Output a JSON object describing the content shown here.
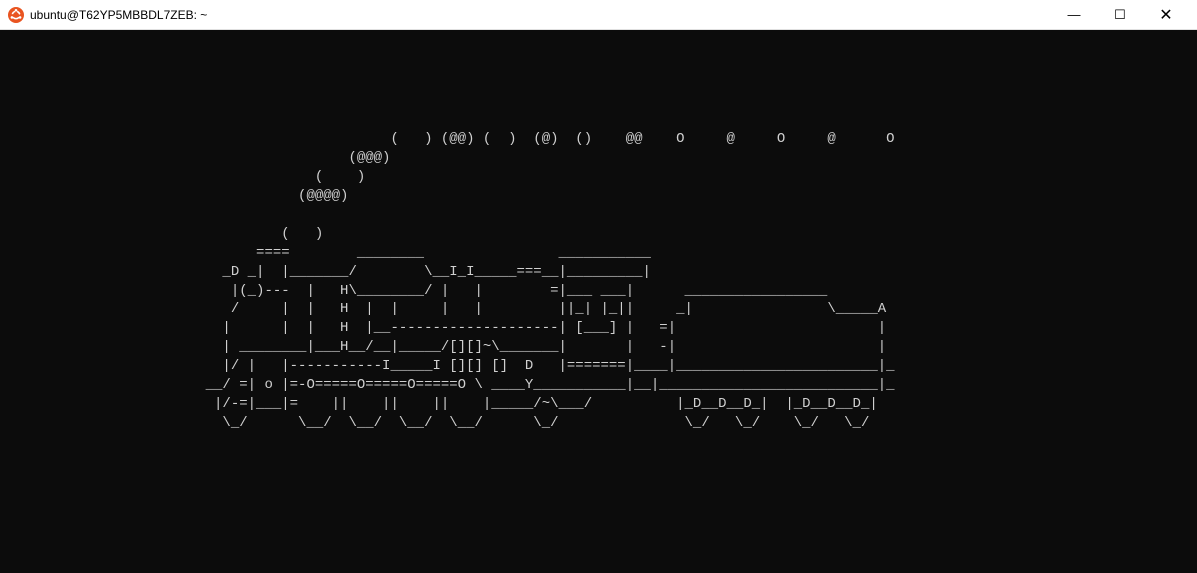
{
  "window": {
    "title": "ubuntu@T62YP5MBBDL7ZEB: ~",
    "minimize_symbol": "—",
    "maximize_symbol": "☐",
    "close_symbol": "✕"
  },
  "terminal": {
    "ascii_art": "\n\n\n\n                                              (   ) (@@) (  )  (@)  ()    @@    O     @     O     @      O\n                                         (@@@)\n                                     (    )\n                                   (@@@@)\n\n                                 (   )\n                              ====        ________                ___________\n                          _D _|  |_______/        \\__I_I_____===__|_________|\n                           |(_)---  |   H\\________/ |   |        =|___ ___|      _________________\n                           /     |  |   H  |  |     |   |         ||_| |_||     _|                \\_____A\n                          |      |  |   H  |__--------------------| [___] |   =|                        |\n                          | ________|___H__/__|_____/[][]~\\_______|       |   -|                        |\n                          |/ |   |-----------I_____I [][] []  D   |=======|____|________________________|_\n                        __/ =| o |=-O=====O=====O=====O \\ ____Y___________|__|__________________________|_\n                         |/-=|___|=    ||    ||    ||    |_____/~\\___/          |_D__D__D_|  |_D__D__D_|\n                          \\_/      \\__/  \\__/  \\__/  \\__/      \\_/               \\_/   \\_/    \\_/   \\_/"
  }
}
